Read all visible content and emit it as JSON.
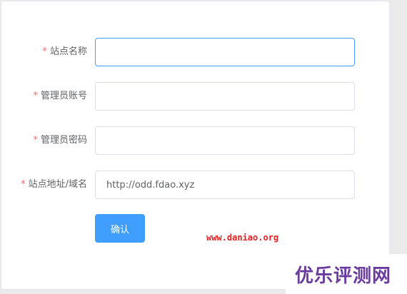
{
  "form": {
    "required_mark": "*",
    "fields": [
      {
        "label": "站点名称",
        "value": "",
        "placeholder": "",
        "focused": true
      },
      {
        "label": "管理员账号",
        "value": "",
        "placeholder": "",
        "focused": false
      },
      {
        "label": "管理员密码",
        "value": "",
        "placeholder": "",
        "focused": false
      },
      {
        "label": "站点地址/域名",
        "value": "http://odd.fdao.xyz",
        "placeholder": "",
        "focused": false
      }
    ],
    "submit_label": "确认"
  },
  "watermarks": {
    "url": "www.daniao.org",
    "brand": "优乐评测网"
  },
  "colors": {
    "primary": "#409eff",
    "required": "#f56c6c",
    "watermark_url": "#e02020",
    "watermark_brand": "#6a3a9c"
  }
}
